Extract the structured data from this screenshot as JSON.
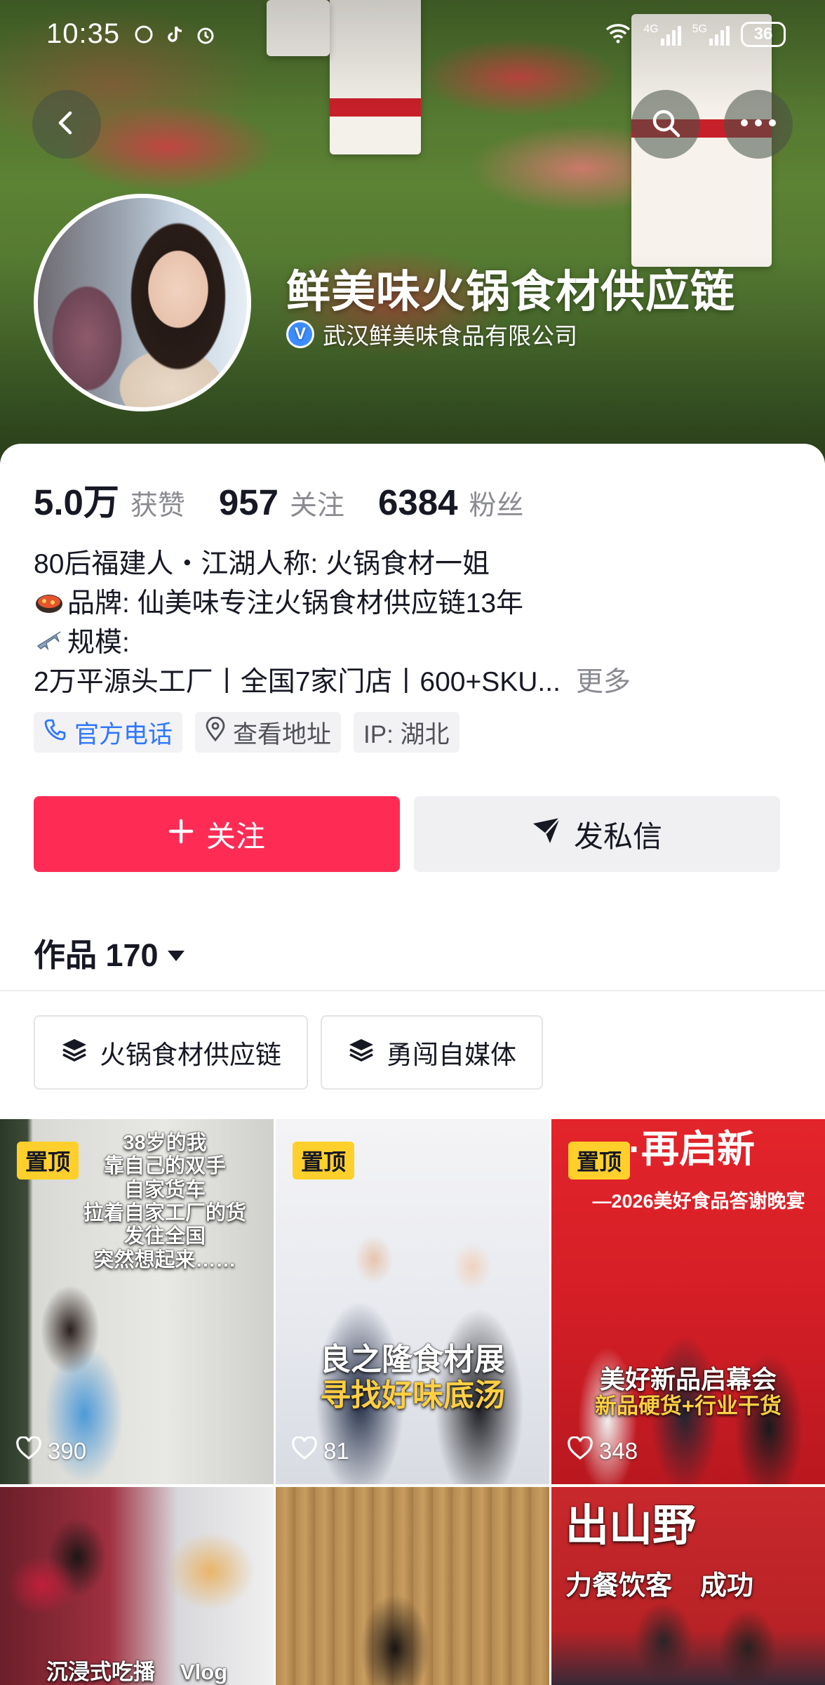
{
  "status_bar": {
    "time": "10:35",
    "network_1": "4G",
    "network_2": "5G",
    "battery": "36"
  },
  "profile": {
    "name": "鲜美味火锅食材供应链",
    "company": "武汉鲜美味食品有限公司",
    "verified_badge": "V"
  },
  "stats": [
    {
      "value": "5.0万",
      "label": "获赞"
    },
    {
      "value": "957",
      "label": "关注"
    },
    {
      "value": "6384",
      "label": "粉丝"
    }
  ],
  "bio": {
    "line1": "80后福建人・江湖人称: 火锅食材一姐",
    "line2": "品牌: 仙美味专注火锅食材供应链13年",
    "line3": "规模:",
    "line4": "2万平源头工厂丨全国7家门店丨600+SKU...",
    "more": "更多"
  },
  "tags": {
    "phone": "官方电话",
    "address": "查看地址",
    "ip": "IP: 湖北"
  },
  "buttons": {
    "follow": "关注",
    "message": "发私信"
  },
  "works": {
    "label": "作品 170"
  },
  "collections": [
    {
      "label": "火锅食材供应链"
    },
    {
      "label": "勇闯自媒体"
    }
  ],
  "videos": [
    {
      "pinned": "置顶",
      "likes": "390",
      "caption": [
        "38岁的我",
        "靠自己的双手",
        "自家货车",
        "拉着自家工厂的货",
        "发往全国",
        "突然想起来……"
      ]
    },
    {
      "pinned": "置顶",
      "likes": "81",
      "caption": [
        "良之隆食材展",
        "寻找好味底汤"
      ]
    },
    {
      "pinned": "置顶",
      "likes": "348",
      "caption": [
        "美好新品启幕会",
        "新品硬货+行业干货"
      ],
      "banner": [
        "·再启新",
        "—2026美好食品答谢晚宴"
      ]
    },
    {
      "caption": [
        "沉浸式吃播",
        "Vlog"
      ]
    },
    {
      "caption": []
    },
    {
      "caption": [
        "出山野",
        "力餐饮客",
        "成功"
      ]
    }
  ],
  "colors": {
    "accent": "#fe2c55",
    "link": "#2f77ff",
    "pin": "#ffd02b"
  }
}
